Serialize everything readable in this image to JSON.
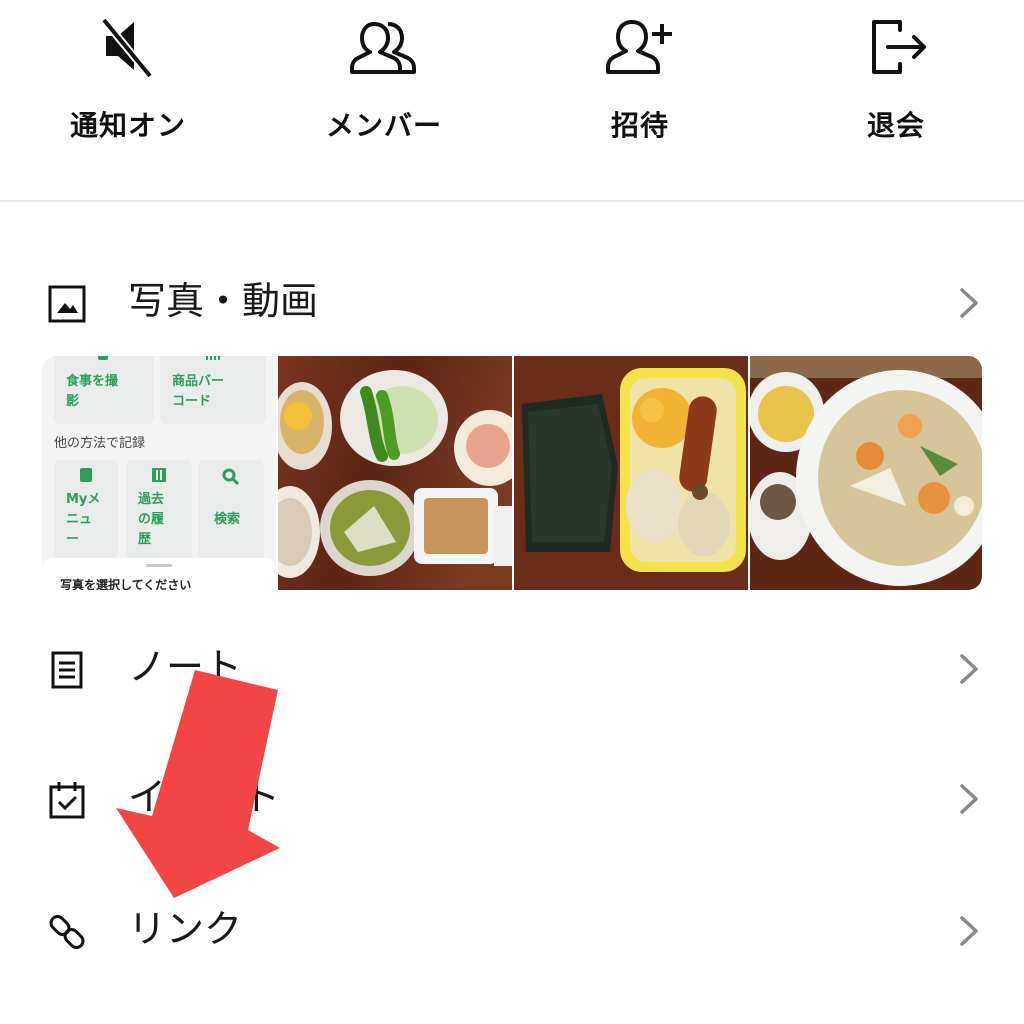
{
  "top_actions": [
    {
      "label": "通知オン",
      "icon": "speaker-muted-icon"
    },
    {
      "label": "メンバー",
      "icon": "members-icon"
    },
    {
      "label": "招待",
      "icon": "add-user-icon"
    },
    {
      "label": "退会",
      "icon": "leave-icon"
    }
  ],
  "media_section": {
    "label": "写真・動画",
    "icon": "photo-icon",
    "screenshot_thumb": {
      "tile1": [
        "食事を撮",
        "影"
      ],
      "tile2": [
        "商品バー",
        "コード"
      ],
      "other_methods": "他の方法で記録",
      "tile3": [
        "Myメ",
        "ニュ",
        "ー"
      ],
      "tile4": [
        "過去",
        "の履",
        "歴"
      ],
      "tile5": "検索",
      "sheet_text": "写真を選択してください"
    }
  },
  "list_items": [
    {
      "label": "ノート",
      "icon": "note-icon"
    },
    {
      "label": "イベント",
      "icon": "calendar-check-icon"
    },
    {
      "label": "リンク",
      "icon": "link-icon"
    }
  ],
  "colors": {
    "accent_green": "#2e9f5a",
    "arrow_red": "#f24646"
  }
}
